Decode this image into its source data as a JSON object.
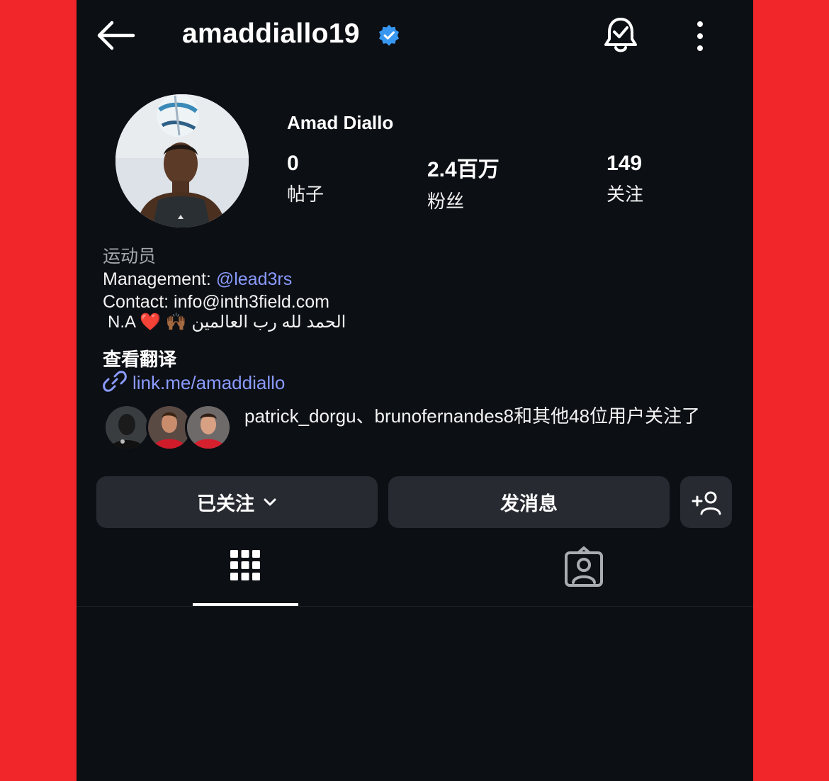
{
  "header": {
    "username": "amaddiallo19",
    "icons": [
      "back-arrow-icon",
      "verified-badge-icon",
      "notification-bell-icon",
      "more-options-icon"
    ],
    "verified_color": "#3897f0"
  },
  "profile": {
    "display_name": "Amad Diallo",
    "stats": [
      {
        "value": "0",
        "label": "帖子"
      },
      {
        "value": "2.4百万",
        "label": "粉丝"
      },
      {
        "value": "149",
        "label": "关注"
      }
    ]
  },
  "bio": {
    "category": "运动员",
    "management_prefix": "Management: ",
    "management_handle": "@lead3rs",
    "contact": "Contact: info@inth3field.com",
    "line3_prefix": "N.A",
    "line3_emoji": "❤️ 🙌🏾",
    "line3_arabic": "الحمد لله رب العالمين",
    "see_translation": "查看翻译",
    "link": "link.me/amaddiallo"
  },
  "followed_by": {
    "text": "patrick_dorgu、brunofernandes8和其他48位用户关注了"
  },
  "buttons": {
    "following": "已关注",
    "message": "发消息"
  },
  "colors": {
    "background": "#0c0f14",
    "frame": "#f0262a",
    "accent_link": "#8a9bff",
    "button_bg": "#272a31"
  }
}
